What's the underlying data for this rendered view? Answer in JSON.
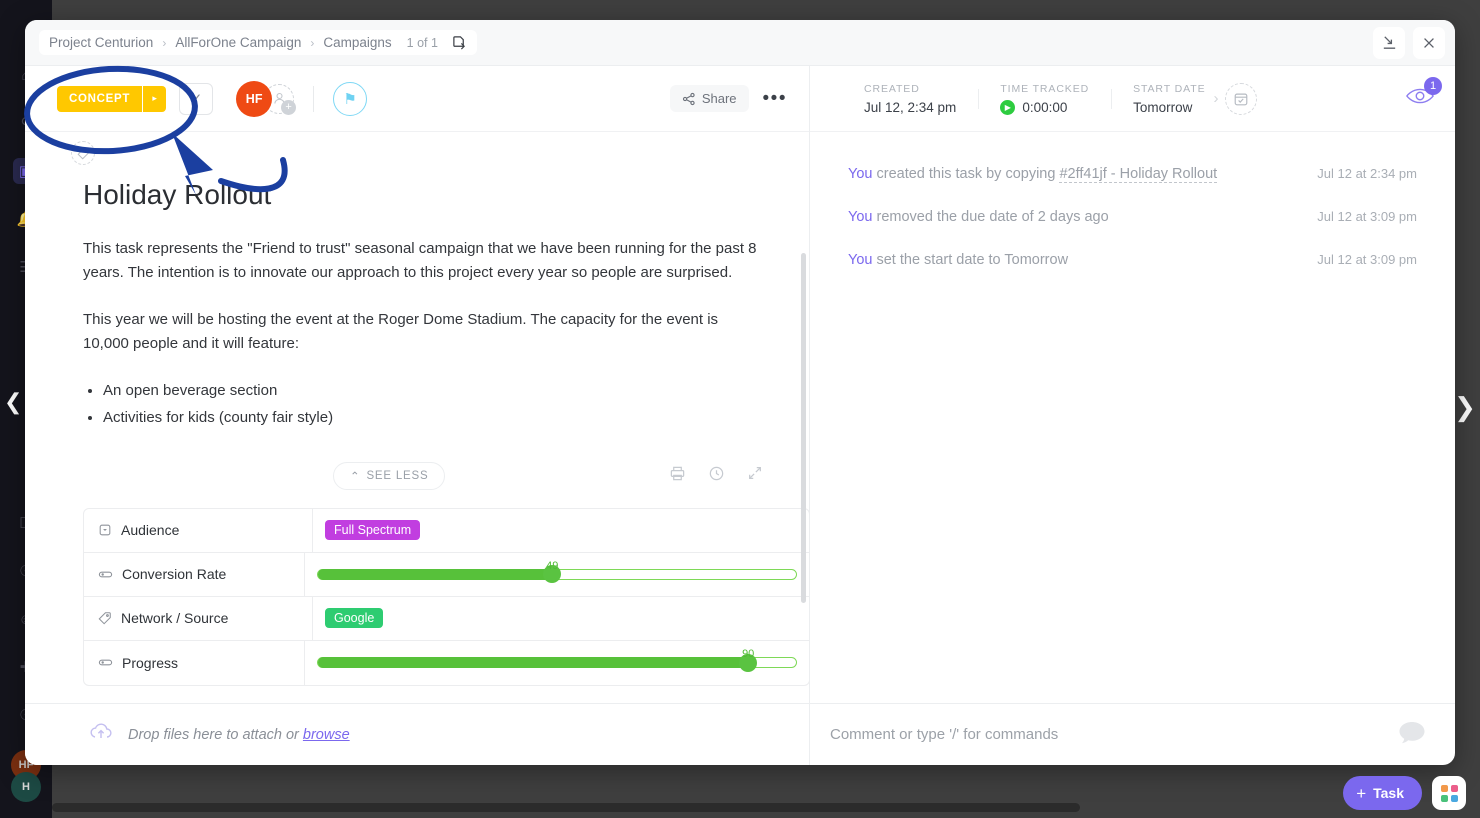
{
  "breadcrumb": {
    "items": [
      "Project Centurion",
      "AllForOne Campaign",
      "Campaigns"
    ],
    "separator": "›",
    "count": "1 of 1",
    "copy_icon": "copy-link-icon"
  },
  "window_controls": {
    "minimize_icon": "collapse-down-icon",
    "close_icon": "close-icon"
  },
  "toolbar": {
    "status_label": "CONCEPT",
    "status_color": "#ffc800",
    "status_arrow": "▸",
    "resolve_icon": "check-icon",
    "assignee_initials": "HF",
    "assignee_color": "#ef4a14",
    "add_assignee_icon": "add-person-icon",
    "priority_icon": "flag-icon",
    "share_label": "Share",
    "share_icon": "share-icon",
    "more_icon": "ellipsis-icon",
    "tag_icon": "tag-icon"
  },
  "task": {
    "title": "Holiday Rollout",
    "description_paragraphs": [
      "This task represents the \"Friend to trust\" seasonal campaign that we have been running for the past 8 years. The intention is to innovate our approach to this project every year so people are surprised.",
      "This year we will be hosting the event at the Roger Dome Stadium. The capacity for the event is 10,000 people and it will feature:"
    ],
    "bullets": [
      "An open beverage section",
      "Activities for kids (county fair style)"
    ],
    "see_less_label": "SEE LESS",
    "see_less_caret": "⌃",
    "desc_tools": [
      "print-icon",
      "history-icon",
      "expand-icon"
    ]
  },
  "custom_fields": [
    {
      "name": "Audience",
      "icon": "dropdown-field-icon",
      "type": "chip",
      "value": "Full Spectrum",
      "color": "#c13ee0"
    },
    {
      "name": "Conversion Rate",
      "icon": "slider-field-icon",
      "type": "slider",
      "value": 49,
      "max": 100,
      "color": "#57c13a"
    },
    {
      "name": "Network / Source",
      "icon": "label-field-icon",
      "type": "chip",
      "value": "Google",
      "color": "#2ecc71"
    },
    {
      "name": "Progress",
      "icon": "slider-field-icon",
      "type": "slider",
      "value": 90,
      "max": 100,
      "color": "#57c13a"
    }
  ],
  "attachments": {
    "icon": "upload-cloud-icon",
    "text": "Drop files here to attach or ",
    "link": "browse"
  },
  "meta": [
    {
      "label": "CREATED",
      "value": "Jul 12, 2:34 pm"
    },
    {
      "label": "TIME TRACKED",
      "value": "0:00:00",
      "icon": "play-icon"
    },
    {
      "label": "START DATE",
      "value": "Tomorrow"
    }
  ],
  "meta_extra": {
    "calendar_icon": "calendar-icon",
    "chevron": "›",
    "watchers_icon": "watchers-eye-icon",
    "watchers_count": "1"
  },
  "activity": [
    {
      "who": "You",
      "text": " created this task by copying ",
      "ref": "#2ff41jf - Holiday Rollout",
      "time": "Jul 12 at 2:34 pm"
    },
    {
      "who": "You",
      "text": " removed the due date of 2 days ago",
      "ref": "",
      "time": "Jul 12 at 3:09 pm"
    },
    {
      "who": "You",
      "text": " set the start date to Tomorrow",
      "ref": "",
      "time": "Jul 12 at 3:09 pm"
    }
  ],
  "comment": {
    "placeholder": "Comment or type '/' for commands",
    "icon": "comment-bubble-icon"
  },
  "app": {
    "fab_task_label": "Task",
    "fab_plus": "+",
    "fab_apps_icon": "apps-grid-icon",
    "nav_prev_icon": "chevron-left-icon",
    "nav_next_icon": "chevron-right-icon",
    "rail_avatar_1": "HF",
    "rail_avatar_2": "H"
  }
}
